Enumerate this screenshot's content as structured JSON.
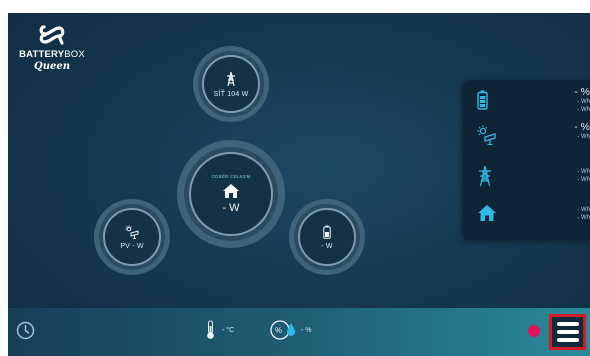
{
  "logo": {
    "brand_bold": "BATTERY",
    "brand_light": "BOX",
    "script": "Queen"
  },
  "grid_node": {
    "icon": "power-tower-icon",
    "label": "SÍŤ 104 W"
  },
  "home_node": {
    "icon": "house-icon",
    "title": "ODBĚR CELKEM",
    "value": "- W"
  },
  "pv_node": {
    "icon": "solar-panel-icon",
    "label": "PV - W"
  },
  "battery_node": {
    "icon": "battery-icon",
    "label": "- W"
  },
  "panel": {
    "battery": {
      "icon": "battery-icon",
      "percent": "- %",
      "line1": "- Wh",
      "line2": "- Wh"
    },
    "pv": {
      "icon": "solar-panel-icon",
      "percent": "- %",
      "line1": "- Wh"
    },
    "grid": {
      "icon": "power-tower-icon",
      "line1": "- Wh",
      "line2": "- Wh"
    },
    "home": {
      "icon": "house-icon",
      "line1": "- Wh",
      "line2": "- Wh"
    }
  },
  "bottom": {
    "temperature": "- °C",
    "humidity": "- %",
    "status_color": "#e0145a"
  },
  "colors": {
    "accent": "#2fb7e6",
    "background": "#163a52",
    "menu_highlight": "#d01c22"
  }
}
